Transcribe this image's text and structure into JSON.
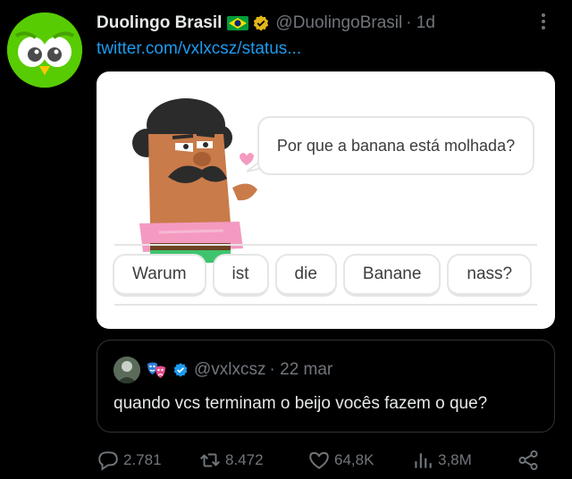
{
  "tweet": {
    "author_name": "Duolingo Brasil",
    "handle": "@DuolingoBrasil",
    "time": "· 1d",
    "link": "twitter.com/vxlxcsz/status..."
  },
  "card": {
    "speech": "Por que a banana está molhada?",
    "words": [
      "Warum",
      "ist",
      "die",
      "Banane",
      "nass?"
    ]
  },
  "quote": {
    "handle": "@vxlxcsz",
    "time": "· 22 mar",
    "text": "quando vcs terminam o beijo vocês fazem o que?"
  },
  "actions": {
    "replies": "2.781",
    "retweets": "8.472",
    "likes": "64,8K",
    "views": "3,8M"
  },
  "colors": {
    "link": "#1d9bf0",
    "muted": "#71767b",
    "brand_green": "#58cc02"
  }
}
